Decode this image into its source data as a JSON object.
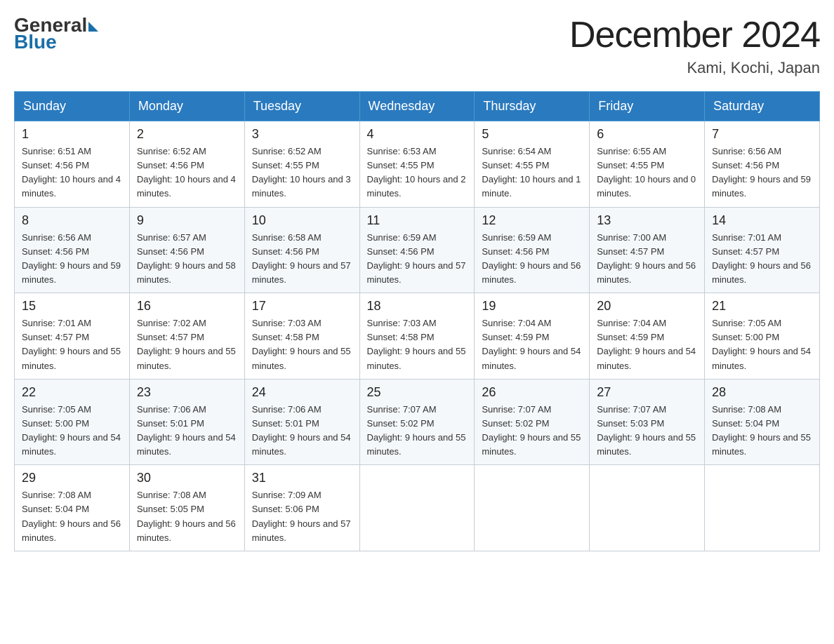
{
  "header": {
    "logo_general": "General",
    "logo_blue": "Blue",
    "month_title": "December 2024",
    "location": "Kami, Kochi, Japan"
  },
  "days_of_week": [
    "Sunday",
    "Monday",
    "Tuesday",
    "Wednesday",
    "Thursday",
    "Friday",
    "Saturday"
  ],
  "weeks": [
    [
      {
        "day": "1",
        "sunrise": "6:51 AM",
        "sunset": "4:56 PM",
        "daylight": "10 hours and 4 minutes."
      },
      {
        "day": "2",
        "sunrise": "6:52 AM",
        "sunset": "4:56 PM",
        "daylight": "10 hours and 4 minutes."
      },
      {
        "day": "3",
        "sunrise": "6:52 AM",
        "sunset": "4:55 PM",
        "daylight": "10 hours and 3 minutes."
      },
      {
        "day": "4",
        "sunrise": "6:53 AM",
        "sunset": "4:55 PM",
        "daylight": "10 hours and 2 minutes."
      },
      {
        "day": "5",
        "sunrise": "6:54 AM",
        "sunset": "4:55 PM",
        "daylight": "10 hours and 1 minute."
      },
      {
        "day": "6",
        "sunrise": "6:55 AM",
        "sunset": "4:55 PM",
        "daylight": "10 hours and 0 minutes."
      },
      {
        "day": "7",
        "sunrise": "6:56 AM",
        "sunset": "4:56 PM",
        "daylight": "9 hours and 59 minutes."
      }
    ],
    [
      {
        "day": "8",
        "sunrise": "6:56 AM",
        "sunset": "4:56 PM",
        "daylight": "9 hours and 59 minutes."
      },
      {
        "day": "9",
        "sunrise": "6:57 AM",
        "sunset": "4:56 PM",
        "daylight": "9 hours and 58 minutes."
      },
      {
        "day": "10",
        "sunrise": "6:58 AM",
        "sunset": "4:56 PM",
        "daylight": "9 hours and 57 minutes."
      },
      {
        "day": "11",
        "sunrise": "6:59 AM",
        "sunset": "4:56 PM",
        "daylight": "9 hours and 57 minutes."
      },
      {
        "day": "12",
        "sunrise": "6:59 AM",
        "sunset": "4:56 PM",
        "daylight": "9 hours and 56 minutes."
      },
      {
        "day": "13",
        "sunrise": "7:00 AM",
        "sunset": "4:57 PM",
        "daylight": "9 hours and 56 minutes."
      },
      {
        "day": "14",
        "sunrise": "7:01 AM",
        "sunset": "4:57 PM",
        "daylight": "9 hours and 56 minutes."
      }
    ],
    [
      {
        "day": "15",
        "sunrise": "7:01 AM",
        "sunset": "4:57 PM",
        "daylight": "9 hours and 55 minutes."
      },
      {
        "day": "16",
        "sunrise": "7:02 AM",
        "sunset": "4:57 PM",
        "daylight": "9 hours and 55 minutes."
      },
      {
        "day": "17",
        "sunrise": "7:03 AM",
        "sunset": "4:58 PM",
        "daylight": "9 hours and 55 minutes."
      },
      {
        "day": "18",
        "sunrise": "7:03 AM",
        "sunset": "4:58 PM",
        "daylight": "9 hours and 55 minutes."
      },
      {
        "day": "19",
        "sunrise": "7:04 AM",
        "sunset": "4:59 PM",
        "daylight": "9 hours and 54 minutes."
      },
      {
        "day": "20",
        "sunrise": "7:04 AM",
        "sunset": "4:59 PM",
        "daylight": "9 hours and 54 minutes."
      },
      {
        "day": "21",
        "sunrise": "7:05 AM",
        "sunset": "5:00 PM",
        "daylight": "9 hours and 54 minutes."
      }
    ],
    [
      {
        "day": "22",
        "sunrise": "7:05 AM",
        "sunset": "5:00 PM",
        "daylight": "9 hours and 54 minutes."
      },
      {
        "day": "23",
        "sunrise": "7:06 AM",
        "sunset": "5:01 PM",
        "daylight": "9 hours and 54 minutes."
      },
      {
        "day": "24",
        "sunrise": "7:06 AM",
        "sunset": "5:01 PM",
        "daylight": "9 hours and 54 minutes."
      },
      {
        "day": "25",
        "sunrise": "7:07 AM",
        "sunset": "5:02 PM",
        "daylight": "9 hours and 55 minutes."
      },
      {
        "day": "26",
        "sunrise": "7:07 AM",
        "sunset": "5:02 PM",
        "daylight": "9 hours and 55 minutes."
      },
      {
        "day": "27",
        "sunrise": "7:07 AM",
        "sunset": "5:03 PM",
        "daylight": "9 hours and 55 minutes."
      },
      {
        "day": "28",
        "sunrise": "7:08 AM",
        "sunset": "5:04 PM",
        "daylight": "9 hours and 55 minutes."
      }
    ],
    [
      {
        "day": "29",
        "sunrise": "7:08 AM",
        "sunset": "5:04 PM",
        "daylight": "9 hours and 56 minutes."
      },
      {
        "day": "30",
        "sunrise": "7:08 AM",
        "sunset": "5:05 PM",
        "daylight": "9 hours and 56 minutes."
      },
      {
        "day": "31",
        "sunrise": "7:09 AM",
        "sunset": "5:06 PM",
        "daylight": "9 hours and 57 minutes."
      },
      null,
      null,
      null,
      null
    ]
  ]
}
